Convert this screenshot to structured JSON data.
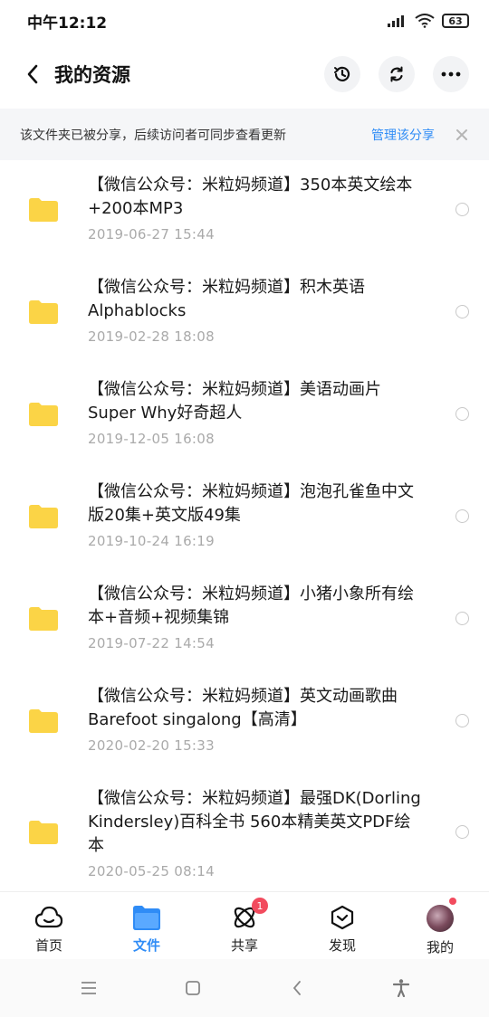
{
  "status": {
    "time": "中午12:12",
    "battery": "63"
  },
  "header": {
    "title": "我的资源"
  },
  "banner": {
    "text": "该文件夹已被分享，后续访问者可同步查看更新",
    "action": "管理该分享"
  },
  "files": [
    {
      "name_line1": "【微信公众号：米粒妈频道】350本英文绘本",
      "name_line2": "+200本MP3",
      "name_line3": "",
      "date": "2019-06-27  15:44"
    },
    {
      "name_line1": "【微信公众号：米粒妈频道】积木英语",
      "name_line2": "Alphablocks",
      "name_line3": "",
      "date": "2019-02-28  18:08"
    },
    {
      "name_line1": "【微信公众号：米粒妈频道】美语动画片",
      "name_line2": "Super Why好奇超人",
      "name_line3": "",
      "date": "2019-12-05  16:08"
    },
    {
      "name_line1": "【微信公众号：米粒妈频道】泡泡孔雀鱼中文",
      "name_line2": "版20集+英文版49集",
      "name_line3": "",
      "date": "2019-10-24  16:19"
    },
    {
      "name_line1": "【微信公众号：米粒妈频道】小猪小象所有绘",
      "name_line2": "本+音频+视频集锦",
      "name_line3": "",
      "date": "2019-07-22  14:54"
    },
    {
      "name_line1": "【微信公众号：米粒妈频道】英文动画歌曲",
      "name_line2": "Barefoot singalong【高清】",
      "name_line3": "",
      "date": "2020-02-20  15:33"
    },
    {
      "name_line1": "【微信公众号：米粒妈频道】最强DK(Dorling",
      "name_line2": "Kindersley)百科全书 560本精美英文PDF绘",
      "name_line3": "本",
      "date": "2020-05-25  08:14"
    }
  ],
  "bottom_nav": {
    "home": "首页",
    "files": "文件",
    "share": "共享",
    "share_badge": "1",
    "discover": "发现",
    "me": "我的"
  },
  "colors": {
    "accent": "#2f8cf6",
    "folder": "#fbd446",
    "badge": "#f24b5e"
  }
}
